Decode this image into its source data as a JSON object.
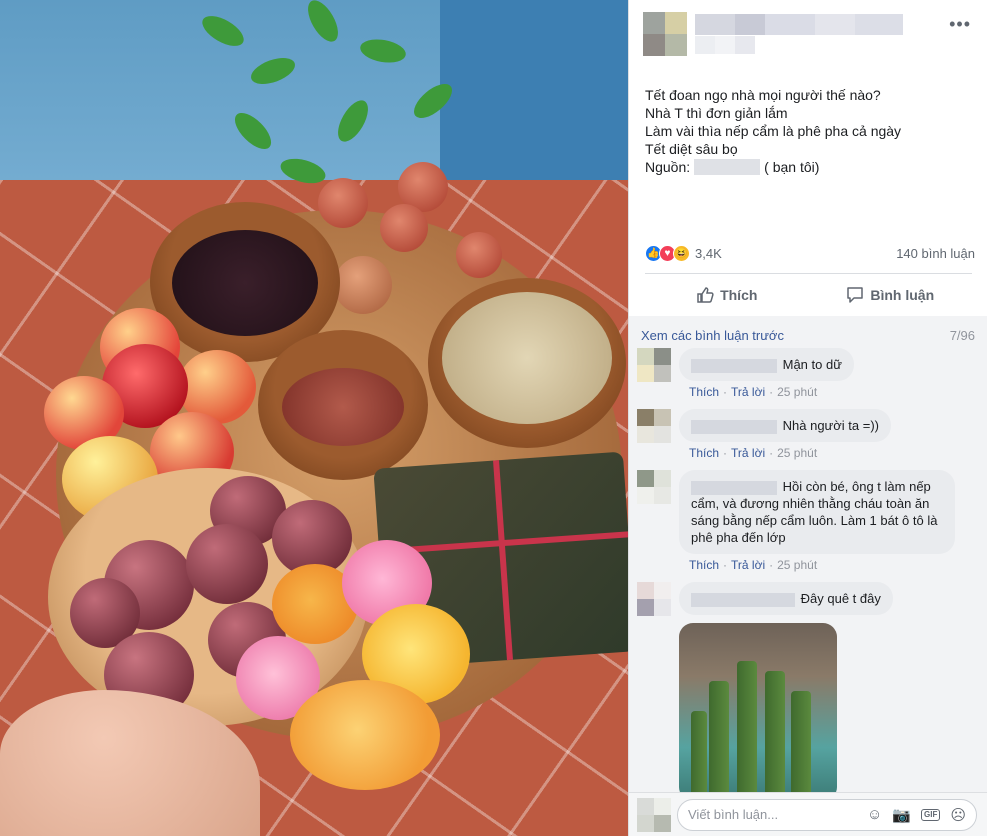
{
  "post": {
    "text_lines": [
      "Tết đoan ngọ nhà mọi người thế nào?",
      "Nhà T thì đơn giản lắm",
      "Làm vài thìa nếp cẩm là phê pha cả ngày",
      "Tết diệt sâu bọ"
    ],
    "source_prefix": "Nguồn:",
    "source_suffix": "( bạn tôi)",
    "reaction_count": "3,4K",
    "comment_count": "140 bình luận",
    "like_label": "Thích",
    "comment_label": "Bình luận",
    "menu_glyph": "•••"
  },
  "comments": {
    "view_previous": "Xem các bình luận trước",
    "counter": "7/96",
    "items": [
      {
        "text": "Mận to dữ",
        "like": "Thích",
        "reply": "Trả lời",
        "time": "25 phút"
      },
      {
        "text": "Nhà người ta =))",
        "like": "Thích",
        "reply": "Trả lời",
        "time": "25 phút"
      },
      {
        "text": "Hồi còn bé, ông t làm nếp cẩm, và đương nhiên thằng cháu toàn ăn sáng bằng nếp cẩm luôn. Làm 1 bát ô tô là phê pha đến lớp",
        "like": "Thích",
        "reply": "Trả lời",
        "time": "25 phút"
      },
      {
        "text": "Đây quê t đây"
      }
    ]
  },
  "composer": {
    "placeholder": "Viết bình luận...",
    "gif_label": "GIF"
  },
  "colors": {
    "link": "#385898",
    "like_blue": "#1877f2",
    "love_red": "#f33e58",
    "haha_yellow": "#f7b928",
    "bubble": "#e9ebee",
    "panel": "#f2f3f5"
  }
}
